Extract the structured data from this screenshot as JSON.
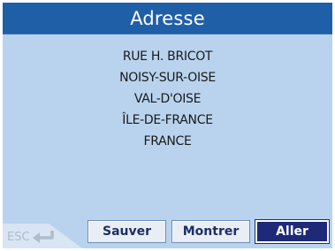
{
  "window": {
    "title": "Adresse"
  },
  "address": {
    "lines": [
      "RUE H. BRICOT",
      "NOISY-SUR-OISE",
      "VAL-D'OISE",
      "ÎLE-DE-FRANCE",
      "FRANCE"
    ]
  },
  "footer": {
    "esc_label": "ESC",
    "esc_icon": "return-arrow-icon",
    "save_label": "Sauver",
    "show_label": "Montrer",
    "go_label": "Aller"
  },
  "colors": {
    "title_bar": "#1f5fa8",
    "content_background": "#b9d3ee",
    "primary_button": "#1e2a78"
  }
}
